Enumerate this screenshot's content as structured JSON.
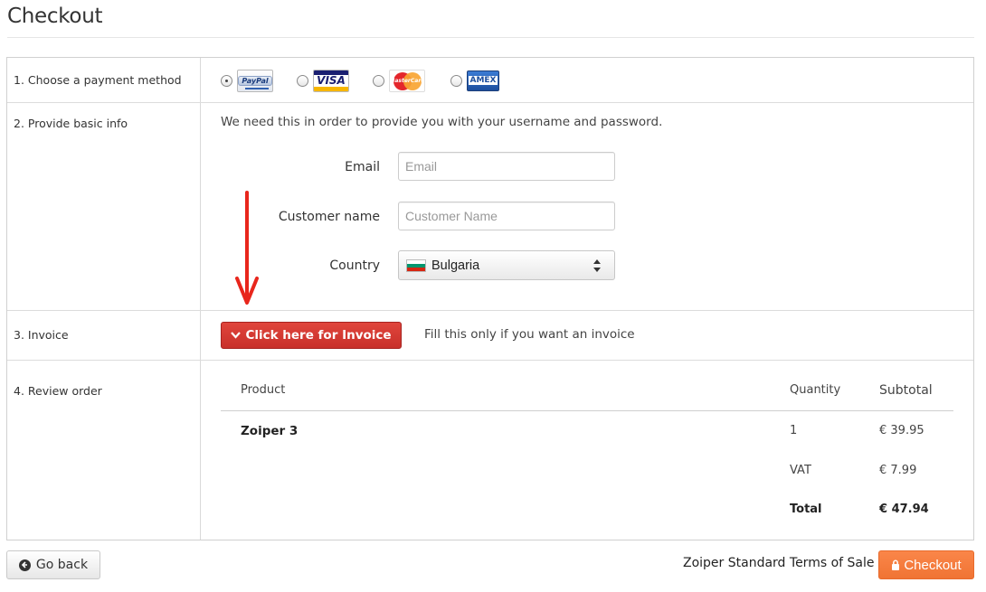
{
  "page": {
    "title": "Checkout"
  },
  "steps": {
    "payment": "1. Choose a payment method",
    "info": "2. Provide basic info",
    "invoice": "3. Invoice",
    "review": "4. Review order"
  },
  "payment_methods": [
    {
      "name": "PayPal",
      "logo_text": "PayPal",
      "selected": true
    },
    {
      "name": "Visa",
      "logo_text": "VISA",
      "selected": false
    },
    {
      "name": "MasterCard",
      "logo_text": "MasterCard",
      "selected": false
    },
    {
      "name": "American Express",
      "logo_text": "AMEX",
      "selected": false
    }
  ],
  "basic_info": {
    "intro": "We need this in order to provide you with your username and password.",
    "email_label": "Email",
    "email_placeholder": "Email",
    "name_label": "Customer name",
    "name_placeholder": "Customer Name",
    "country_label": "Country",
    "country_value": "Bulgaria",
    "country_flag_colors": [
      "#ffffff",
      "#00966e",
      "#d62612"
    ]
  },
  "invoice": {
    "button_label": "Click here for Invoice",
    "button_icon": "chevron-down-icon",
    "note": "Fill this only if you want an invoice"
  },
  "review": {
    "headers": {
      "product": "Product",
      "quantity": "Quantity",
      "subtotal": "Subtotal"
    },
    "item": {
      "product": "Zoiper 3",
      "quantity": "1",
      "subtotal": "€ 39.95"
    },
    "vat": {
      "label": "VAT",
      "value": "€ 7.99"
    },
    "total": {
      "label": "Total",
      "value": "€ 47.94"
    }
  },
  "footer": {
    "back_label": "Go back",
    "back_icon": "arrow-left-circle-icon",
    "terms": "Zoiper Standard Terms of Sale",
    "checkout_label": "Checkout",
    "checkout_icon": "lock-icon"
  },
  "colors": {
    "invoice_button": "#d9403a",
    "checkout_button": "#f47c3c",
    "annotation_arrow": "#e8261c"
  }
}
